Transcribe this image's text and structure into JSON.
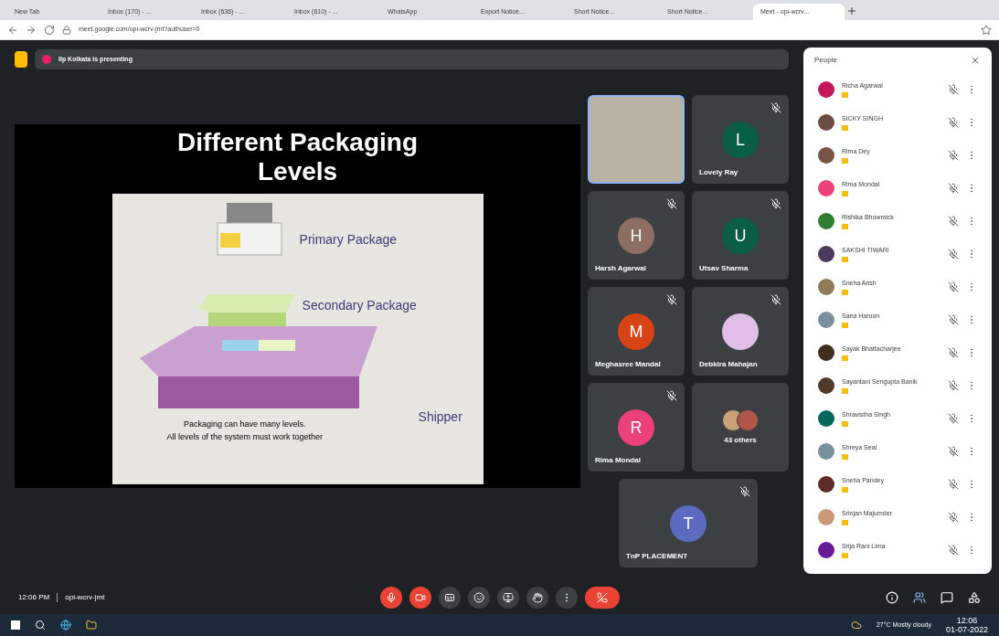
{
  "browser": {
    "tabs": [
      {
        "title": "New Tab",
        "selected": false
      },
      {
        "title": "Inbox (170) - ...",
        "selected": false
      },
      {
        "title": "Inbox (636) - ...",
        "selected": false
      },
      {
        "title": "Inbox (610) - ...",
        "selected": false
      },
      {
        "title": "WhatsApp",
        "selected": false
      },
      {
        "title": "Export Notice...",
        "selected": false
      },
      {
        "title": "Short Notice...",
        "selected": false
      },
      {
        "title": "Short Notice...",
        "selected": false
      },
      {
        "title": "Meet - opi-wcrv...",
        "selected": true
      }
    ],
    "url": "meet.google.com/opi-wcrv-jmt?authuser=0"
  },
  "presenter_label": "Ilp Kolkata is presenting",
  "slide": {
    "title": "Different Packaging Levels",
    "labels": [
      "Primary Package",
      "Secondary Package",
      "Shipper"
    ],
    "caption": [
      "Packaging can have many levels.",
      "All levels of the system must work together"
    ]
  },
  "tiles": [
    {
      "kind": "video"
    },
    {
      "kind": "avatar",
      "name": "Lovely Ray",
      "initial": "L",
      "color": "#0b5e46"
    },
    {
      "kind": "avatar",
      "name": "Harsh Agarwal",
      "initial": "H",
      "color": "#8d6e63"
    },
    {
      "kind": "avatar",
      "name": "Utsav Sharma",
      "initial": "U",
      "color": "#0b5e46"
    },
    {
      "kind": "avatar",
      "name": "Meghasree Mandal",
      "initial": "M",
      "color": "#d84315"
    },
    {
      "kind": "avatar",
      "name": "Debkira Mahajan",
      "color": "#e1bee7"
    },
    {
      "kind": "avatar",
      "name": "Rima Mondal",
      "initial": "R",
      "color": "#ec407a"
    },
    {
      "kind": "others",
      "name": "43 others"
    },
    {
      "kind": "avatar",
      "name": "TnP PLACEMENT",
      "initial": "T",
      "color": "#5c6bc0"
    }
  ],
  "people": {
    "title": "People",
    "items": [
      {
        "name": "Richa Agarwal",
        "color": "#c2185b"
      },
      {
        "name": "SICKY SINGH",
        "color": "#6d4c41"
      },
      {
        "name": "Rima Dey",
        "color": "#795548"
      },
      {
        "name": "Rima Mondal",
        "color": "#ec407a"
      },
      {
        "name": "Rishika Bhowmick",
        "color": "#2e7d32"
      },
      {
        "name": "SAKSHI TIWARI",
        "color": "#4a3b5c"
      },
      {
        "name": "Sneha Ansh",
        "color": "#8d7b5a"
      },
      {
        "name": "Sana Haroon",
        "color": "#78909c"
      },
      {
        "name": "Sayak Bhattacharjee",
        "color": "#3e2f1c"
      },
      {
        "name": "Sayantani Sengupta Banik",
        "color": "#4e3b2a"
      },
      {
        "name": "Shravistha Singh",
        "color": "#00695c"
      },
      {
        "name": "Shreya Seal",
        "color": "#78909c"
      },
      {
        "name": "Sneha Pandey",
        "color": "#5d2a2a"
      },
      {
        "name": "Srinjan Majumder",
        "color": "#c99a7a"
      },
      {
        "name": "Srija Rani Lima",
        "color": "#6a1b9a"
      }
    ]
  },
  "bottom": {
    "time": "12:06 PM",
    "code": "opi-wcrv-jmt"
  },
  "taskbar": {
    "weather": "27°C Mostly cloudy",
    "time": "12:06",
    "date": "01-07-2022"
  }
}
